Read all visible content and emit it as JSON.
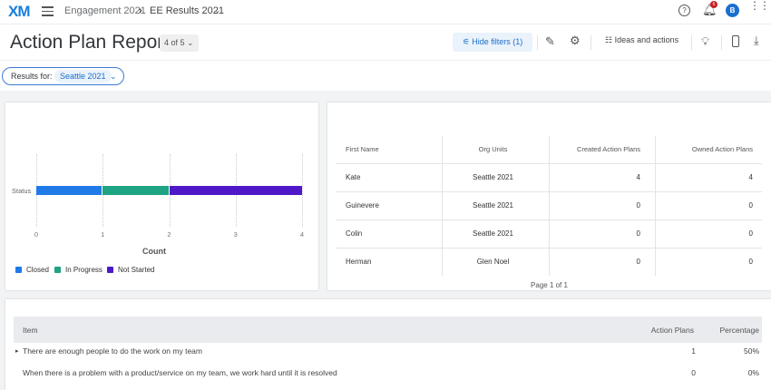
{
  "header": {
    "logo": "XM",
    "breadcrumb_project": "Engagement 2021",
    "breadcrumb_sep": "›",
    "breadcrumb_current": "EE Results 2021",
    "notifications_count": "6",
    "avatar_initial": "B"
  },
  "titlebar": {
    "title": "Action Plan Report",
    "pager": "4 of 5",
    "hide_filters": "Hide filters (1)",
    "ideas": "Ideas and actions"
  },
  "filter": {
    "label": "Results for:",
    "value": "Seattle 2021"
  },
  "chart_data": {
    "type": "bar",
    "orientation": "horizontal",
    "stacked": true,
    "categories": [
      "Status"
    ],
    "series": [
      {
        "name": "Closed",
        "values": [
          1
        ],
        "color": "#1f7ae8"
      },
      {
        "name": "In Progress",
        "values": [
          1
        ],
        "color": "#1ea383"
      },
      {
        "name": "Not Started",
        "values": [
          2
        ],
        "color": "#4e18c8"
      }
    ],
    "xlabel": "Count",
    "xlim": [
      0,
      4
    ],
    "xticks": [
      "0",
      "1",
      "2",
      "3",
      "4"
    ],
    "legend": "bottom-left",
    "grid": true
  },
  "table": {
    "headers": [
      "First Name",
      "Org Units",
      "Created Action Plans",
      "Owned Action Plans"
    ],
    "rows": [
      [
        "Kate",
        "Seattle 2021",
        "4",
        "4"
      ],
      [
        "Guinevere",
        "Seattle 2021",
        "0",
        "0"
      ],
      [
        "Colin",
        "Seattle 2021",
        "0",
        "0"
      ],
      [
        "Herman",
        "Glen Noel",
        "0",
        "0"
      ]
    ],
    "footer": "Page 1 of 1"
  },
  "items": {
    "headers": [
      "Item",
      "Action Plans",
      "Percentage"
    ],
    "rows": [
      [
        "There are enough people to do the work on my team",
        "1",
        "50%"
      ],
      [
        "When there is a problem with a product/service on my team, we work hard until it is resolved",
        "0",
        "0%"
      ]
    ]
  }
}
